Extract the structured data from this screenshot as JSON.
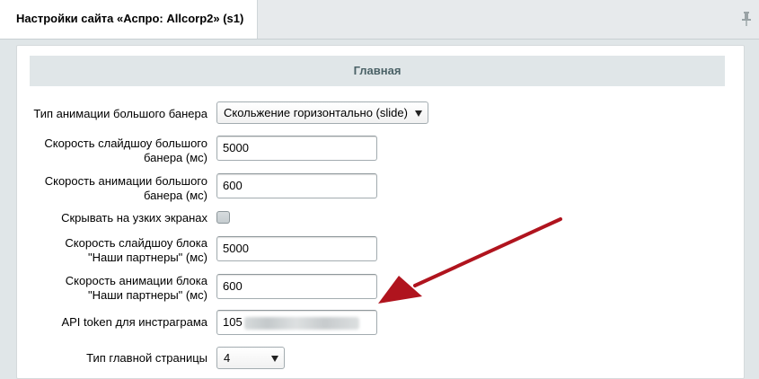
{
  "header": {
    "tab_title": "Настройки сайта «Аспро: Allcorp2» (s1)",
    "pin_icon": "pin-icon"
  },
  "section": {
    "title": "Главная"
  },
  "fields": {
    "banner_anim_type": {
      "label": "Тип анимации большого банера",
      "value": "Скольжение горизонтально (slide)"
    },
    "banner_slideshow_speed": {
      "label": "Скорость слайдшоу большого банера (мс)",
      "value": "5000"
    },
    "banner_anim_speed": {
      "label": "Скорость анимации большого банера (мс)",
      "value": "600"
    },
    "hide_narrow": {
      "label": "Скрывать на узких экранах",
      "checked": false
    },
    "partners_slideshow_speed": {
      "label": "Скорость слайдшоу блока \"Наши партнеры\" (мс)",
      "value": "5000"
    },
    "partners_anim_speed": {
      "label": "Скорость анимации блока \"Наши партнеры\" (мс)",
      "value": "600"
    },
    "instagram_token": {
      "label": "API token для инстраграма",
      "value_visible": "105"
    },
    "main_page_type": {
      "label": "Тип главной страницы",
      "value": "4"
    }
  },
  "annotation": {
    "arrow_color": "#b0141e"
  },
  "colors": {
    "background": "#e0e6e8",
    "section_header": "#e0e6e8",
    "section_title_text": "#4b6267"
  }
}
